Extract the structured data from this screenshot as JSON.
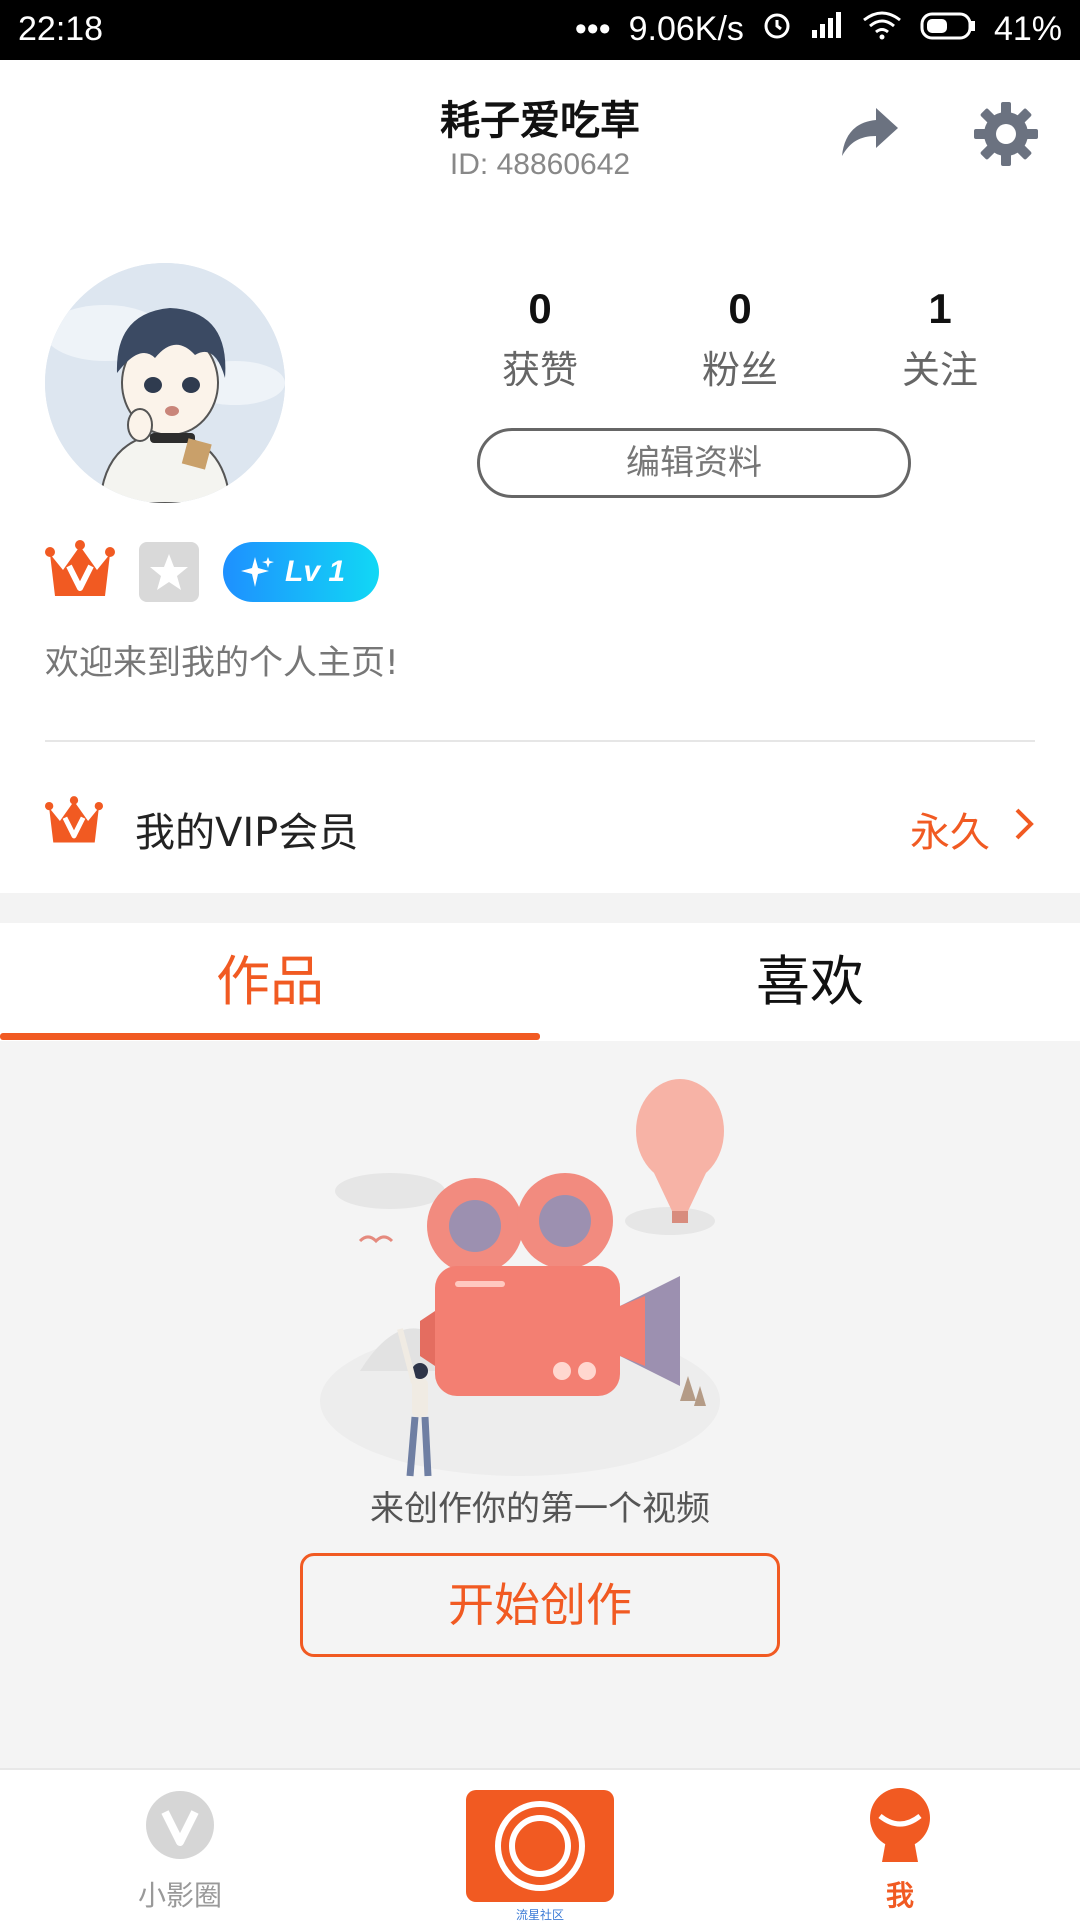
{
  "status_bar": {
    "time": "22:18",
    "dots": "•••",
    "speed": "9.06K/s",
    "battery": "41%",
    "icons": [
      "alarm-icon",
      "signal-icon",
      "wifi-icon",
      "battery-icon"
    ]
  },
  "header": {
    "username": "耗子爱吃草",
    "user_id": "ID: 48860642",
    "icons": [
      "share-icon",
      "settings-icon"
    ]
  },
  "profile": {
    "stats": [
      {
        "value": "0",
        "label": "获赞"
      },
      {
        "value": "0",
        "label": "粉丝"
      },
      {
        "value": "1",
        "label": "关注"
      }
    ],
    "edit_button": "编辑资料",
    "level_badge": "Lv 1",
    "bio": "欢迎来到我的个人主页!"
  },
  "vip": {
    "label": "我的VIP会员",
    "value": "永久"
  },
  "tabs": [
    {
      "label": "作品",
      "active": true
    },
    {
      "label": "喜欢",
      "active": false
    }
  ],
  "empty_state": {
    "message": "来创作你的第一个视频",
    "button": "开始创作"
  },
  "bottom_nav": {
    "items": [
      {
        "label": "小影圈",
        "icon": "circle-v-icon"
      },
      {
        "label": "流星社区",
        "icon": "record-icon"
      },
      {
        "label": "我",
        "icon": "me-icon"
      }
    ]
  },
  "colors": {
    "accent": "#f15a22",
    "level_badge": "#1e90ff",
    "background_gray": "#f4f4f4"
  }
}
